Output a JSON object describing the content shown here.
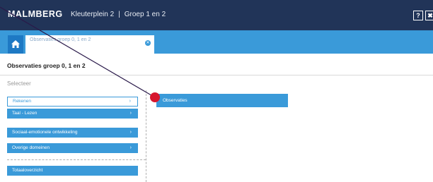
{
  "topbar": {
    "logo": "MALMBERG",
    "school": "Kleuterplein 2",
    "separator": "|",
    "group": "Groep 1 en 2",
    "help_label": "?",
    "close_label": "✖"
  },
  "tabs": {
    "active_tab_label": "Observaties groep 0, 1 en 2",
    "close_label": "✕"
  },
  "page": {
    "title": "Observaties groep 0, 1 en 2",
    "select_label": "Selecteer"
  },
  "menu": [
    {
      "label": "Rekenen",
      "chevron": "›",
      "selected": true
    },
    {
      "label": "Taal - Lezen",
      "chevron": "›",
      "selected": false
    },
    {
      "label": "Sociaal-emotionele ontwikkeling",
      "chevron": "›",
      "selected": false
    },
    {
      "label": "Overige domeinen",
      "chevron": "›",
      "selected": false
    }
  ],
  "overview_button": "Totaaloverzicht",
  "submenu": [
    {
      "label": "Observaties"
    }
  ],
  "colors": {
    "topbar": "#213458",
    "accent": "#3a9ad9",
    "annotation": "#d6162e"
  }
}
